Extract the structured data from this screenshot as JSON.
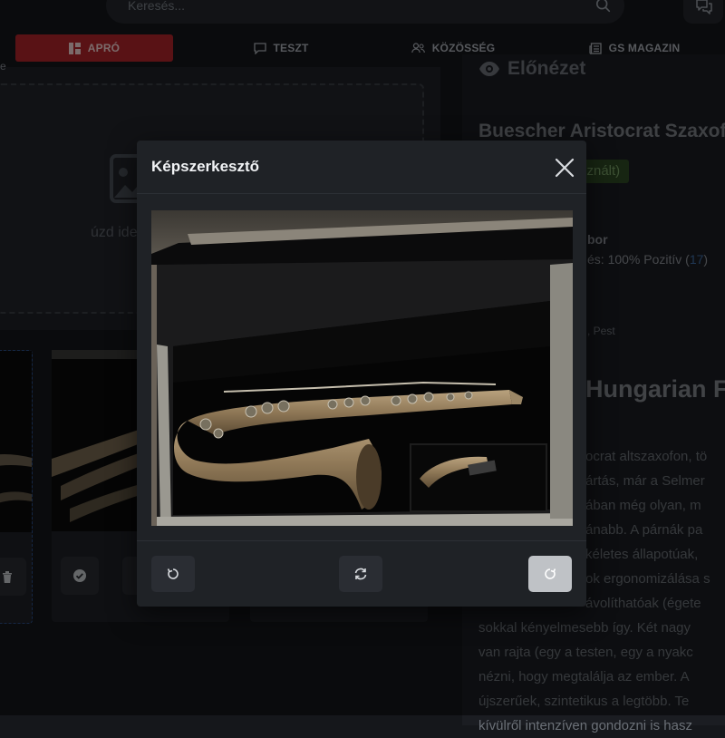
{
  "header": {
    "search_placeholder": "Keresés...",
    "nav": [
      {
        "label": "APRÓ",
        "active": true
      },
      {
        "label": "TESZT",
        "active": false
      },
      {
        "label": "KÖZÖSSÉG",
        "active": false
      },
      {
        "label": "GS MAGAZIN",
        "active": false
      }
    ]
  },
  "upload": {
    "label_fragment": "e",
    "dropzone_text": "úzd ide képet vagy k"
  },
  "preview": {
    "title": "Előnézet",
    "item_title": "Buescher Aristocrat Szaxofo",
    "condition_badge": "sznált)",
    "seller_fragment": "bor",
    "rating_prefix": "és: 100% Pozitív (",
    "rating_count": "17",
    "rating_suffix": ")",
    "location_fragment": ", Pest",
    "heading_fragment": "Hungarian F",
    "description_lines": [
      "ocrat altszaxofon, tö",
      "ártás, már a Selmer",
      "ában még olyan, m",
      "ánabb. A párnák pa",
      "kéletes állapotúak,",
      "ok ergonomizálása s",
      "ávolíthatóak (égete",
      "sokkal kényelmesebb így. Két nagy",
      "van rajta (egy a testen, egy a nyakc",
      "nézni, hogy megtalálja az ember. A",
      "újszerűek, szintetikus a legtöbb. Te",
      "kívülről intenzíven gondozni is hasz"
    ]
  },
  "modal": {
    "title": "Képszerkesztő"
  },
  "colors": {
    "accent": "#b3242a",
    "modal_bg": "#1f2226",
    "page_bg": "#15171b"
  }
}
